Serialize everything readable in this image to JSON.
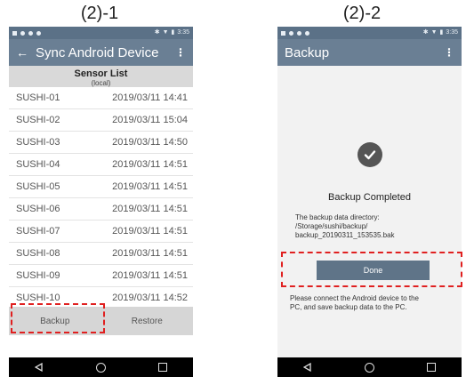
{
  "labels": {
    "left": "(2)-1",
    "right": "(2)-2"
  },
  "status": {
    "time": "3:35"
  },
  "screen1": {
    "title": "Sync Android Device",
    "back_icon": "←",
    "menu_icon": "⋮",
    "header_title": "Sensor List",
    "header_sub": "(local)",
    "rows": [
      {
        "name": "SUSHI-01",
        "time": "2019/03/11  14:41"
      },
      {
        "name": "SUSHI-02",
        "time": "2019/03/11  15:04"
      },
      {
        "name": "SUSHI-03",
        "time": "2019/03/11  14:50"
      },
      {
        "name": "SUSHI-04",
        "time": "2019/03/11  14:51"
      },
      {
        "name": "SUSHI-05",
        "time": "2019/03/11  14:51"
      },
      {
        "name": "SUSHI-06",
        "time": "2019/03/11  14:51"
      },
      {
        "name": "SUSHI-07",
        "time": "2019/03/11  14:51"
      },
      {
        "name": "SUSHI-08",
        "time": "2019/03/11  14:51"
      },
      {
        "name": "SUSHI-09",
        "time": "2019/03/11  14:51"
      },
      {
        "name": "SUSHI-10",
        "time": "2019/03/11  14:52"
      }
    ],
    "backup_label": "Backup",
    "restore_label": "Restore"
  },
  "screen2": {
    "title": "Backup",
    "menu_icon": "⋮",
    "completed": "Backup Completed",
    "dir_line1": "The backup data directory:",
    "dir_line2": "/Storage/sushi/backup/",
    "dir_line3": "backup_20190311_153535.bak",
    "done_label": "Done",
    "note_line1": "Please connect the Android device to the",
    "note_line2": "PC, and save backup data to the PC."
  },
  "colors": {
    "appbar": "#6a7f94",
    "statusbar": "#5b7187",
    "highlight": "#e02020"
  }
}
